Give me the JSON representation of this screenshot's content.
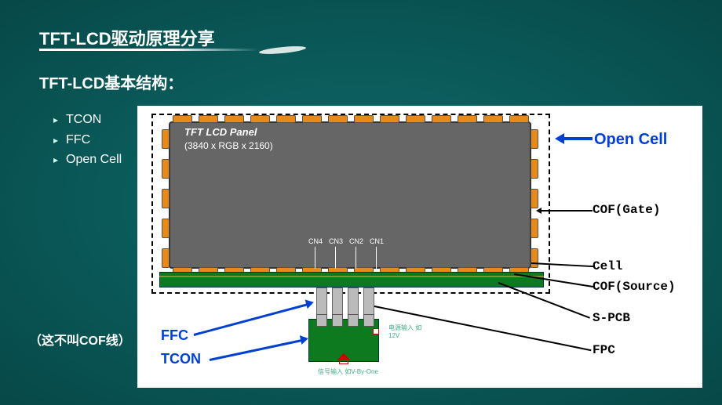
{
  "title": "TFT-LCD驱动原理分享",
  "subtitle": "TFT-LCD基本结构：",
  "bullets": [
    "TCON",
    "FFC",
    "Open Cell"
  ],
  "note": "（这不叫COF线）",
  "panel": {
    "title": "TFT LCD Panel",
    "res": "(3840 x RGB x 2160)"
  },
  "connectors": {
    "cn1": "CN1",
    "cn2": "CN2",
    "cn3": "CN3",
    "cn4": "CN4"
  },
  "labels": {
    "open_cell": "Open Cell",
    "cof_gate": "COF(Gate)",
    "cell": "Cell",
    "cof_source": "COF(Source)",
    "s_pcb": "S-PCB",
    "fpc": "FPC",
    "ffc": "FFC",
    "tcon": "TCON"
  },
  "signals": {
    "power": "电源输入 如12V",
    "video": "信号输入 如V-By-One"
  }
}
